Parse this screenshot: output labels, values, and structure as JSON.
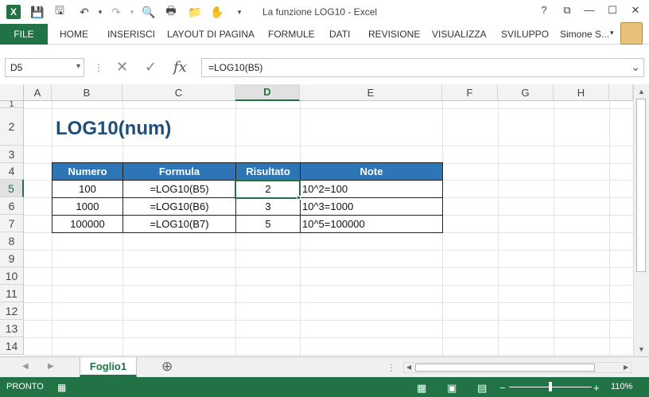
{
  "window": {
    "title": "La funzione LOG10 - Excel",
    "help": "?",
    "restore_ribbon": "⧉",
    "minimize": "—",
    "maximize": "☐",
    "close": "✕"
  },
  "ribbon": {
    "file": "FILE",
    "tabs": [
      "HOME",
      "INSERISCI",
      "LAYOUT DI PAGINA",
      "FORMULE",
      "DATI",
      "REVISIONE",
      "VISUALIZZA",
      "SVILUPPO"
    ],
    "user": "Simone S..."
  },
  "formula_bar": {
    "name_box": "D5",
    "formula": "=LOG10(B5)",
    "fx": "fx"
  },
  "grid": {
    "columns": [
      "A",
      "B",
      "C",
      "D",
      "E",
      "F",
      "G",
      "H"
    ],
    "rows": [
      "1",
      "2",
      "3",
      "4",
      "5",
      "6",
      "7",
      "8",
      "9",
      "10",
      "11",
      "12",
      "13",
      "14"
    ],
    "active_column": "D",
    "active_row": "5"
  },
  "sheet": {
    "title": "LOG10(num)",
    "table": {
      "headers": [
        "Numero",
        "Formula",
        "Risultato",
        "Note"
      ],
      "rows": [
        [
          "100",
          "=LOG10(B5)",
          "2",
          "10^2=100"
        ],
        [
          "1000",
          "=LOG10(B6)",
          "3",
          "10^3=1000"
        ],
        [
          "100000",
          "=LOG10(B7)",
          "5",
          "10^5=100000"
        ]
      ]
    }
  },
  "sheet_tabs": {
    "active": "Foglio1",
    "add": "⊕"
  },
  "status_bar": {
    "mode": "PRONTO",
    "zoom": "110%",
    "zoom_fraction": 0.5
  },
  "colors": {
    "accent": "#217346",
    "header_fill": "#2e75b6",
    "title_color": "#1f4e79"
  }
}
